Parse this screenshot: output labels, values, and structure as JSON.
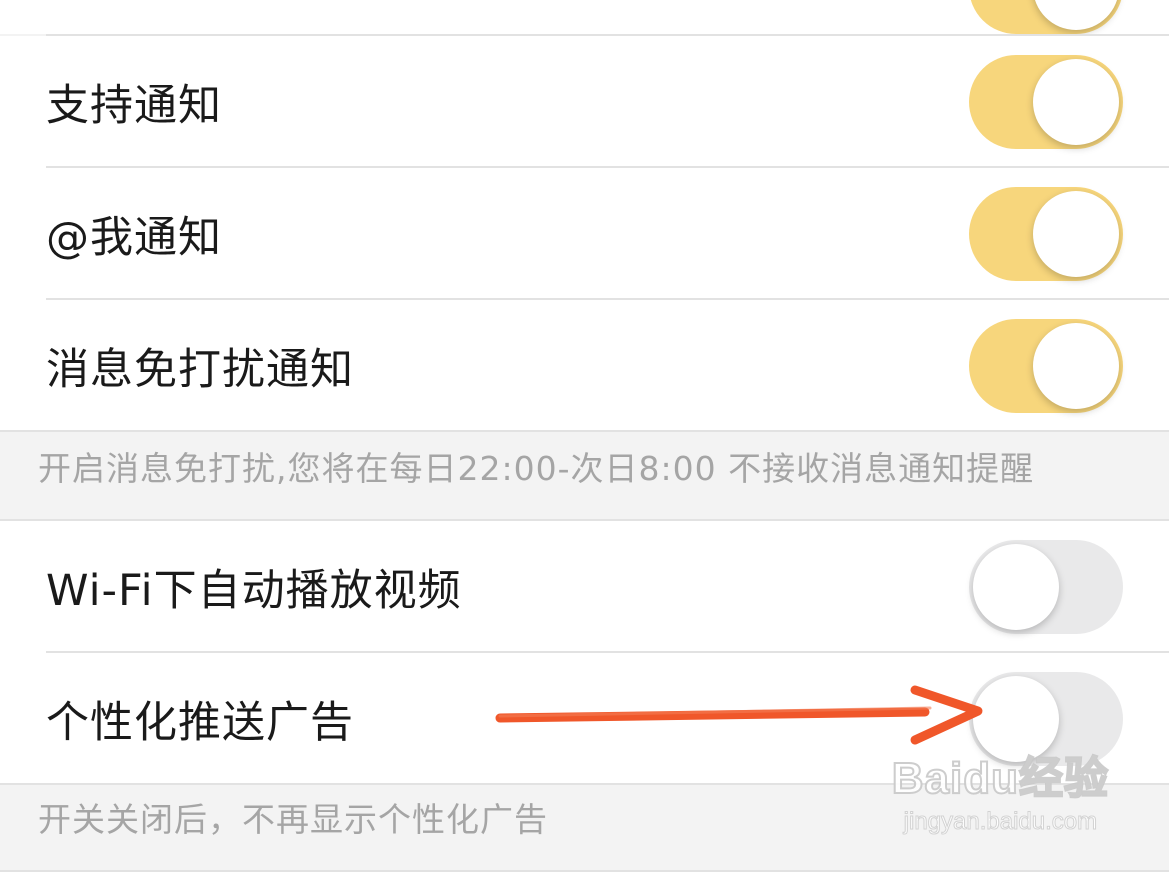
{
  "settings": {
    "rows": [
      {
        "label": "支持通知",
        "enabled": true
      },
      {
        "label": "@我通知",
        "enabled": true
      },
      {
        "label": "消息免打扰通知",
        "enabled": true
      },
      {
        "label": "Wi-Fi下自动播放视频",
        "enabled": false
      },
      {
        "label": "个性化推送广告",
        "enabled": false
      }
    ],
    "dnd_note": "开启消息免打扰,您将在每日22:00-次日8:00 不接收消息通知提醒",
    "ads_note": "开关关闭后，不再显示个性化广告"
  },
  "annotation": {
    "arrow_color": "#f0572a",
    "target": "个性化推送广告 toggle"
  },
  "watermark": {
    "logo": "Baidu经验",
    "url": "jingyan.baidu.com"
  },
  "colors": {
    "toggle_on": "#f7d67c",
    "toggle_off": "#e9e9ea",
    "background": "#f3f3f3"
  }
}
